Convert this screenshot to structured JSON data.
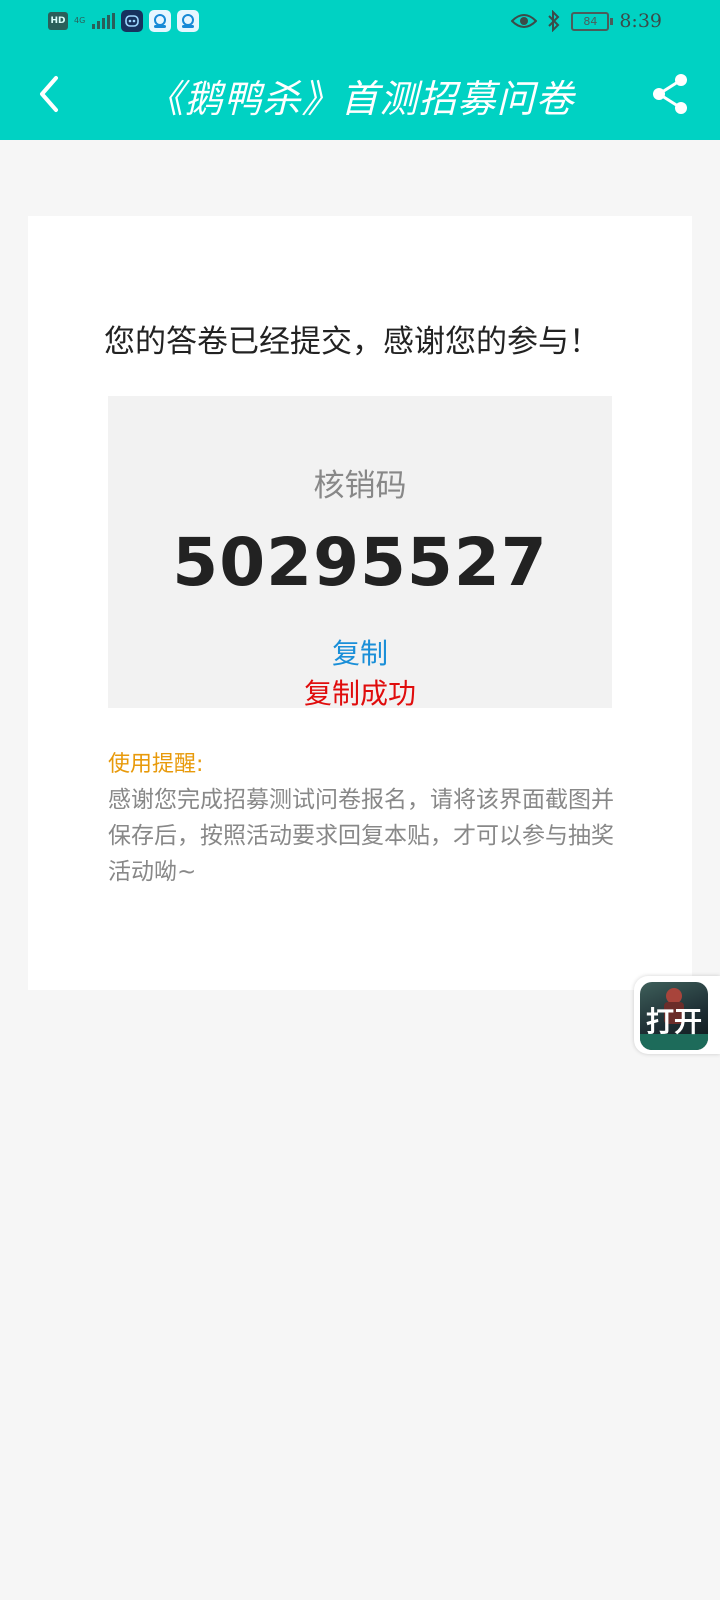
{
  "status_bar": {
    "network": "4G",
    "battery": "84",
    "time": "8:39"
  },
  "navbar": {
    "title": "《鹅鸭杀》首测招募问卷"
  },
  "result": {
    "message": "您的答卷已经提交，感谢您的参与！",
    "code_label": "核销码",
    "code_value": "50295527",
    "copy_label": "复制",
    "copy_status": "复制成功"
  },
  "reminder": {
    "title": "使用提醒:",
    "text": "感谢您完成招募测试问卷报名，请将该界面截图并保存后，按照活动要求回复本贴，才可以参与抽奖活动呦~"
  },
  "floating_button": {
    "label": "打开"
  },
  "colors": {
    "accent": "#00d2c3",
    "copy_link": "#1a8fd8",
    "copy_success": "#e00d0d",
    "reminder_title": "#e89a0b"
  }
}
